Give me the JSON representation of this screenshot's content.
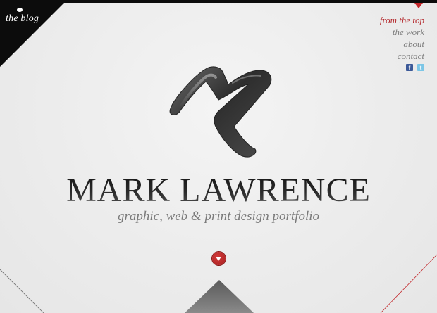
{
  "corner": {
    "blog_label": "the blog"
  },
  "nav": {
    "items": [
      {
        "label": "from the top",
        "active": true
      },
      {
        "label": "the work",
        "active": false
      },
      {
        "label": "about",
        "active": false
      },
      {
        "label": "contact",
        "active": false
      }
    ]
  },
  "social": {
    "facebook_glyph": "f",
    "twitter_glyph": "t"
  },
  "hero": {
    "logo_icon": "m-monogram-logo",
    "name": "MARK LAWRENCE",
    "tagline": "graphic, web & print design portfolio"
  },
  "scroll": {
    "icon": "chevron-down-icon"
  },
  "colors": {
    "accent": "#b3262a",
    "background": "#ececec",
    "text_dark": "#1c1c1c",
    "text_muted": "#7a7a7a"
  }
}
